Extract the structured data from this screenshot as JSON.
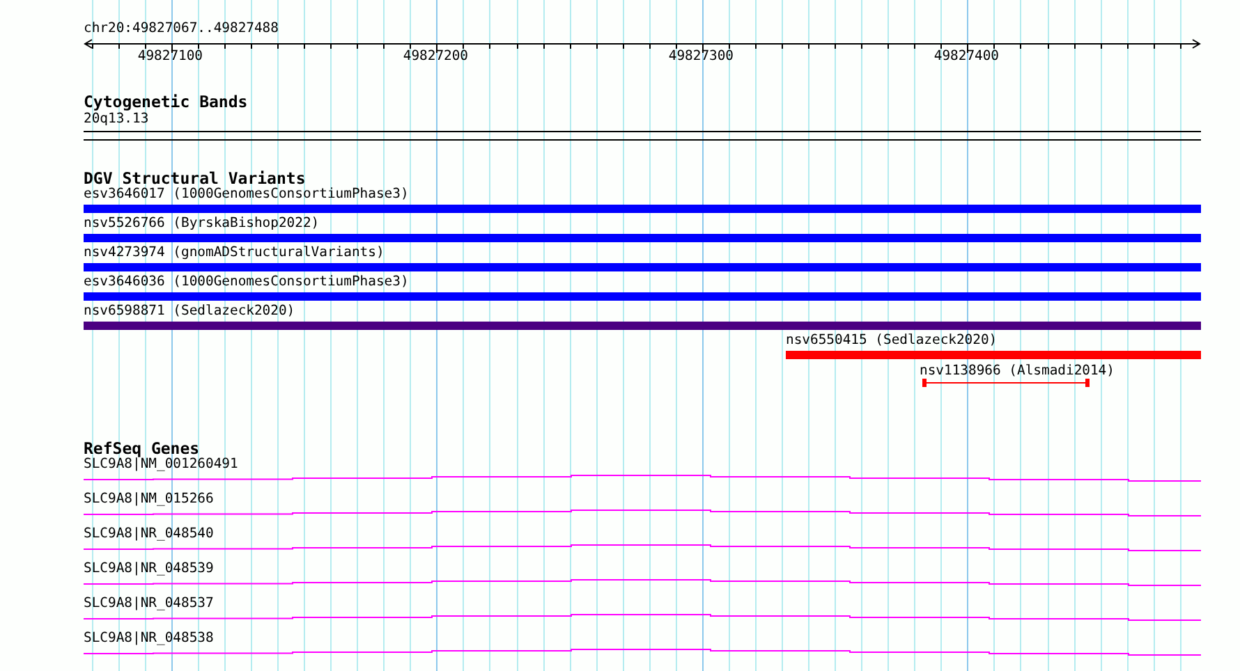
{
  "position": "chr20:49827067..49827488",
  "ruler": {
    "ticks": [
      "49827100",
      "49827200",
      "49827300",
      "49827400"
    ]
  },
  "tracks": [
    {
      "kind": "bands",
      "title": "Cytogenetic Bands",
      "items": [
        {
          "label": "20q13.13"
        }
      ]
    },
    {
      "kind": "variants",
      "title": "DGV Structural Variants",
      "items": [
        {
          "kind": "bar",
          "label": "esv3646017 (1000GenomesConsortiumPhase3)",
          "color": "#0000ff"
        },
        {
          "kind": "bar",
          "label": "nsv5526766 (ByrskaBishop2022)",
          "color": "#0000ff"
        },
        {
          "kind": "bar",
          "label": "nsv4273974 (gnomADStructuralVariants)",
          "color": "#0000ff"
        },
        {
          "kind": "bar",
          "label": "esv3646036 (1000GenomesConsortiumPhase3)",
          "color": "#0000ff"
        },
        {
          "kind": "bar",
          "label": "nsv6598871 (Sedlazeck2020)",
          "color": "#4b0082"
        },
        {
          "kind": "bar",
          "label": "nsv6550415 (Sedlazeck2020)",
          "color": "#ff0000"
        },
        {
          "kind": "span",
          "label": "nsv1138966 (Alsmadi2014)",
          "color": "#ff0000"
        }
      ]
    },
    {
      "kind": "genes",
      "title": "RefSeq Genes",
      "items": [
        {
          "label": "SLC9A8|NM_001260491"
        },
        {
          "label": "SLC9A8|NM_015266"
        },
        {
          "label": "SLC9A8|NR_048540"
        },
        {
          "label": "SLC9A8|NR_048539"
        },
        {
          "label": "SLC9A8|NR_048537"
        },
        {
          "label": "SLC9A8|NR_048538"
        }
      ]
    }
  ]
}
